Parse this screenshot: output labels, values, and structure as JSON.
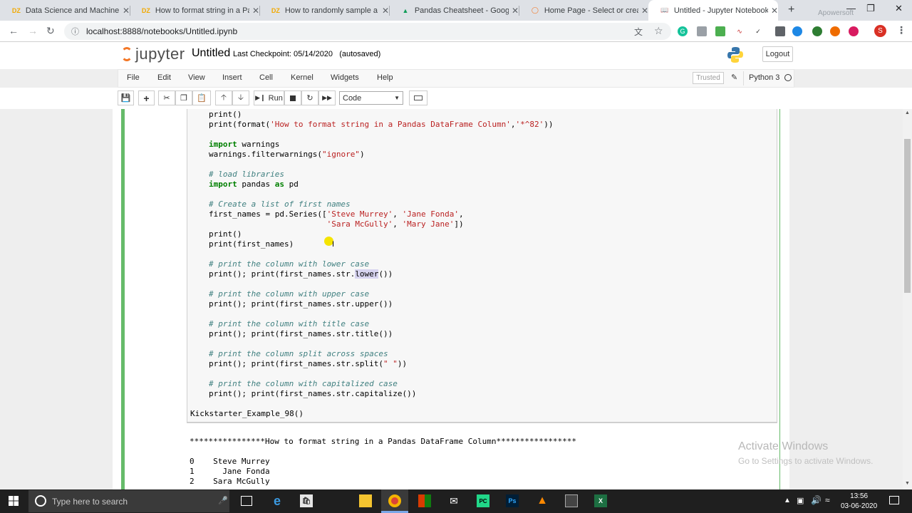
{
  "browser": {
    "tabs": [
      {
        "icon": "DZ",
        "title": "Data Science and Machine Le",
        "color": "#f2a900"
      },
      {
        "icon": "DZ",
        "title": "How to format string in a Par",
        "color": "#f2a900"
      },
      {
        "icon": "DZ",
        "title": "How to randomly sample a P",
        "color": "#f2a900"
      },
      {
        "icon": "drive",
        "title": "Pandas Cheatsheet - Google",
        "color": "#0f9d58"
      },
      {
        "icon": "ring",
        "title": "Home Page - Select or creat",
        "color": "#f37726"
      },
      {
        "icon": "book",
        "title": "Untitled - Jupyter Notebook",
        "color": "#f37726"
      }
    ],
    "new_tab": "+",
    "url": "localhost:8888/notebooks/Untitled.ipynb",
    "profile_initial": "S",
    "window_controls": {
      "minimize": "—",
      "restore": "❐",
      "close": "✕"
    },
    "overlay_watermark": "Apowersoft"
  },
  "jupyter": {
    "logo_text": "jupyter",
    "notebook_title": "Untitled",
    "checkpoint": "Last Checkpoint: 05/14/2020",
    "save_status": "(autosaved)",
    "logout_label": "Logout",
    "menu": [
      "File",
      "Edit",
      "View",
      "Insert",
      "Cell",
      "Kernel",
      "Widgets",
      "Help"
    ],
    "trusted_label": "Trusted",
    "kernel_name": "Python 3",
    "toolbar": {
      "run_label": "Run",
      "cell_type": "Code"
    }
  },
  "code_lines": [
    {
      "t": "print()"
    },
    {
      "t": "print(format('How to format string in a Pandas DataFrame Column','*^82'))"
    },
    {
      "t": ""
    },
    {
      "t": "import warnings"
    },
    {
      "t": "warnings.filterwarnings(\"ignore\")"
    },
    {
      "t": ""
    },
    {
      "t": "# load libraries"
    },
    {
      "t": "import pandas as pd"
    },
    {
      "t": ""
    },
    {
      "t": "# Create a list of first names"
    },
    {
      "t": "first_names = pd.Series(['Steve Murrey', 'Jane Fonda',"
    },
    {
      "t": "                         'Sara McGully', 'Mary Jane'])"
    },
    {
      "t": "print()"
    },
    {
      "t": "print(first_names)"
    },
    {
      "t": ""
    },
    {
      "t": "# print the column with lower case"
    },
    {
      "t": "print(); print(first_names.str.lower())"
    },
    {
      "t": ""
    },
    {
      "t": "# print the column with upper case"
    },
    {
      "t": "print(); print(first_names.str.upper())"
    },
    {
      "t": ""
    },
    {
      "t": "# print the column with title case"
    },
    {
      "t": "print(); print(first_names.str.title())"
    },
    {
      "t": ""
    },
    {
      "t": "# print the column split across spaces"
    },
    {
      "t": "print(); print(first_names.str.split(\" \"))"
    },
    {
      "t": ""
    },
    {
      "t": "# print the column with capitalized case"
    },
    {
      "t": "print(); print(first_names.str.capitalize())"
    }
  ],
  "call_line": "Kickstarter_Example_98()",
  "output_lines": [
    "****************How to format string in a Pandas DataFrame Column*****************",
    "",
    "0    Steve Murrey",
    "1      Jane Fonda",
    "2    Sara McGully"
  ],
  "windows_watermark": {
    "line1": "Activate Windows",
    "line2": "Go to Settings to activate Windows."
  },
  "taskbar": {
    "search_placeholder": "Type here to search",
    "time": "13:56",
    "date": "03-06-2020"
  }
}
